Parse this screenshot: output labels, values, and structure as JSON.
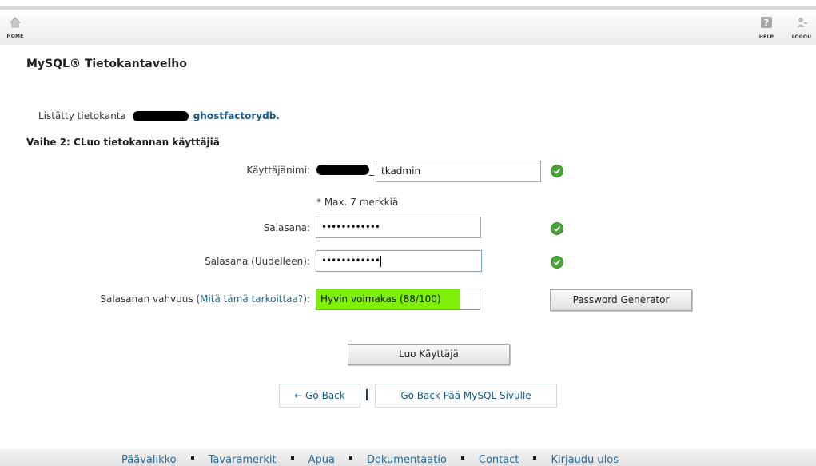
{
  "topbar": {
    "home_label": "HOME",
    "help_label": "HELP",
    "logout_label": "LOGOU"
  },
  "page_title": "MySQL® Tietokantavelho",
  "listed": {
    "prefix": "Listätty tietokanta",
    "db_suffix": "_ghostfactorydb."
  },
  "step_title": "Vaihe 2: CLuo tietokannan käyttäjiä",
  "form": {
    "username_label": "Käyttäjänimi:",
    "username_value": "tkadmin",
    "username_hint": "* Max. 7 merkkiä",
    "password_label": "Salasana:",
    "password_value": "••••••••••••",
    "password_repeat_label": "Salasana (Uudelleen):",
    "password_repeat_value": "••••••••••••",
    "strength_label": "Salasanan vahvuus (",
    "strength_link": "Mitä tämä tarkoittaa?",
    "strength_label_end": "):",
    "strength_text": "Hyvin voimakas (88/100)",
    "strength_value": 88,
    "strength_fill_color": "#7ff008",
    "password_generator_label": "Password Generator",
    "create_user_label": "Luo Käyttäjä"
  },
  "nav": {
    "go_back_label": "← Go Back",
    "go_back_main_label": "Go Back Pää MySQL Sivulle"
  },
  "footer": {
    "links": [
      "Päävalikko",
      "Tavaramerkit",
      "Apua",
      "Dokumentaatio",
      "Contact",
      "Kirjaudu ulos"
    ]
  },
  "icons": {
    "valid": "check-circle-icon",
    "home": "home-icon",
    "help": "help-icon",
    "logout": "logout-icon"
  }
}
